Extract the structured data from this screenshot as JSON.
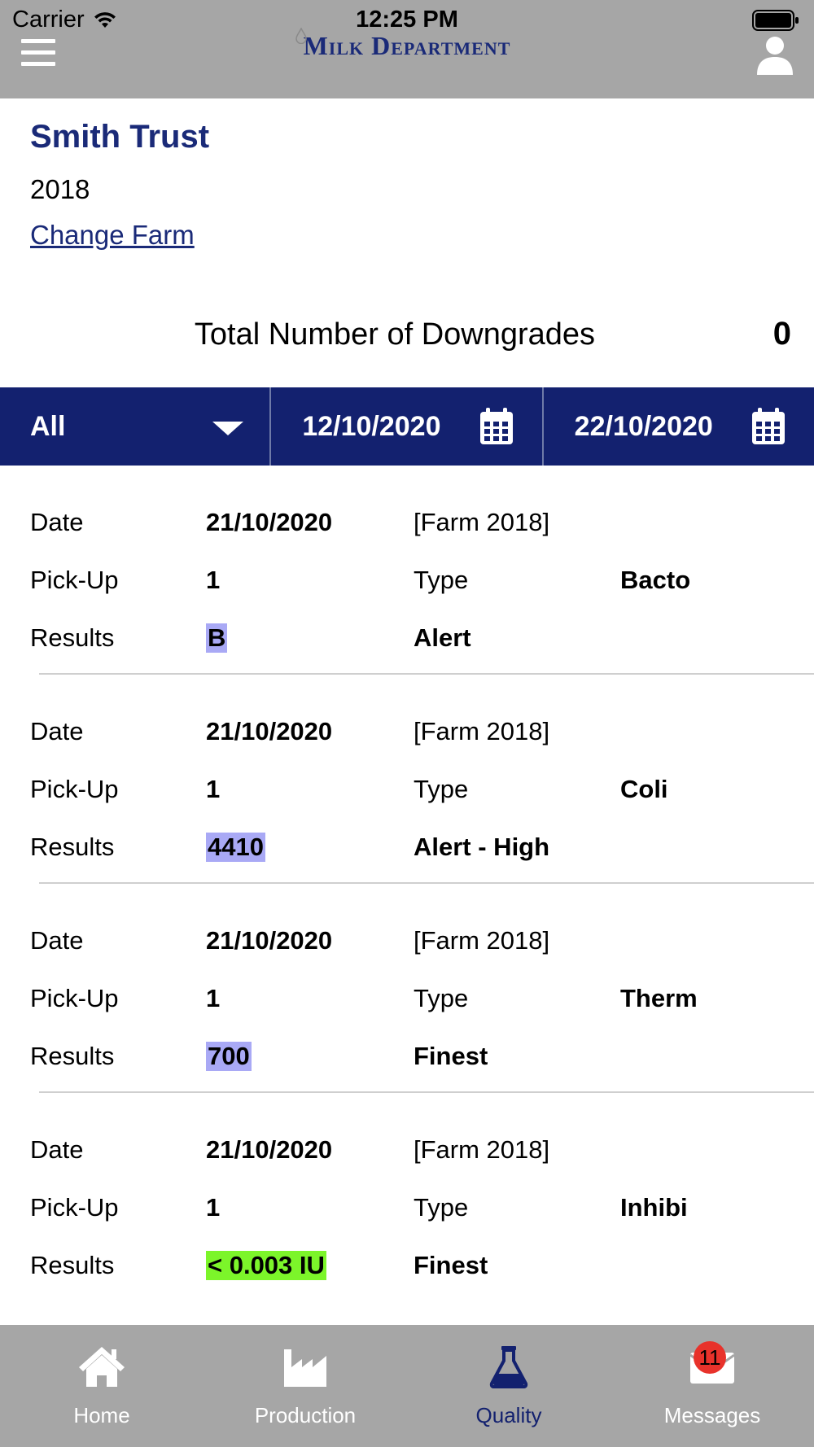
{
  "status_bar": {
    "carrier": "Carrier",
    "time": "12:25 PM"
  },
  "header": {
    "logo_text": "Milk Department",
    "menu_icon": "hamburger-menu-icon",
    "profile_icon": "user-profile-icon"
  },
  "farm": {
    "name": "Smith Trust",
    "year": "2018",
    "change_link": "Change Farm"
  },
  "summary": {
    "label": "Total Number of Downgrades",
    "value": "0"
  },
  "filters": {
    "type_selected": "All",
    "start_date": "12/10/2020",
    "end_date": "22/10/2020"
  },
  "labels": {
    "date": "Date",
    "pickup": "Pick-Up",
    "type": "Type",
    "results": "Results"
  },
  "records": [
    {
      "date": "21/10/2020",
      "farm": "[Farm 2018]",
      "pickup": "1",
      "type": "Bacto",
      "result": "B",
      "result_color": "#a9a9f5",
      "grade": "Alert"
    },
    {
      "date": "21/10/2020",
      "farm": "[Farm 2018]",
      "pickup": "1",
      "type": "Coli",
      "result": "4410",
      "result_color": "#a9a9f5",
      "grade": "Alert - High"
    },
    {
      "date": "21/10/2020",
      "farm": "[Farm 2018]",
      "pickup": "1",
      "type": "Therm",
      "result": "700",
      "result_color": "#a9a9f5",
      "grade": "Finest"
    },
    {
      "date": "21/10/2020",
      "farm": "[Farm 2018]",
      "pickup": "1",
      "type": "Inhibi",
      "result": "< 0.003 IU",
      "result_color": "#7cf52a",
      "grade": "Finest"
    }
  ],
  "tabs": [
    {
      "label": "Home",
      "icon": "home-icon"
    },
    {
      "label": "Production",
      "icon": "factory-icon"
    },
    {
      "label": "Quality",
      "icon": "flask-icon",
      "active": true
    },
    {
      "label": "Messages",
      "icon": "envelope-icon",
      "badge": "11"
    }
  ],
  "colors": {
    "brand_navy": "#13216f",
    "bar_gray": "#a6a6a6",
    "badge_red": "#e8322b"
  }
}
